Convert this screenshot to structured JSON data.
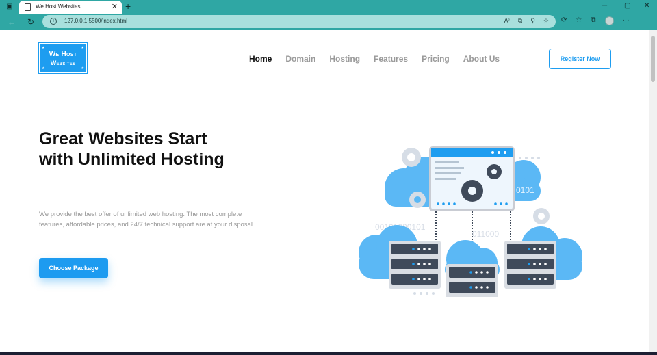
{
  "browser": {
    "tab_title": "We Host Websites!",
    "tab_close": "✕",
    "new_tab": "+",
    "url": "127.0.0.1:5500/index.html",
    "window_controls": [
      "─",
      "▢",
      "✕"
    ],
    "nav_icons": [
      "back-icon",
      "reload-icon"
    ],
    "url_tools": [
      "A⁾",
      "⧉",
      "⚲",
      "☆"
    ],
    "right_tools": [
      "⟳",
      "☆",
      "⧉"
    ],
    "more": "···"
  },
  "header": {
    "logo_line1": "We Host",
    "logo_line2": "Websites",
    "nav_items": [
      {
        "label": "Home",
        "active": true
      },
      {
        "label": "Domain",
        "active": false
      },
      {
        "label": "Hosting",
        "active": false
      },
      {
        "label": "Features",
        "active": false
      },
      {
        "label": "Pricing",
        "active": false
      },
      {
        "label": "About Us",
        "active": false
      }
    ],
    "register_label": "Register Now"
  },
  "hero": {
    "title": "Great Websites Start with Unlimited Hosting",
    "description": "We provide the best offer of unlimited web hosting. The most complete features, affordable prices, and 24/7 technical support are at your disposal.",
    "cta_label": "Choose Package"
  },
  "illustration": {
    "binary_1": "0101",
    "binary_2": "00101000101",
    "binary_3": "011000",
    "binary_4": "0010101"
  },
  "colors": {
    "accent": "#1e9df0",
    "chrome": "#2fa7a4",
    "cloud": "#5bb8f5",
    "server": "#d9dde3",
    "server_slot": "#3f4a5a"
  }
}
